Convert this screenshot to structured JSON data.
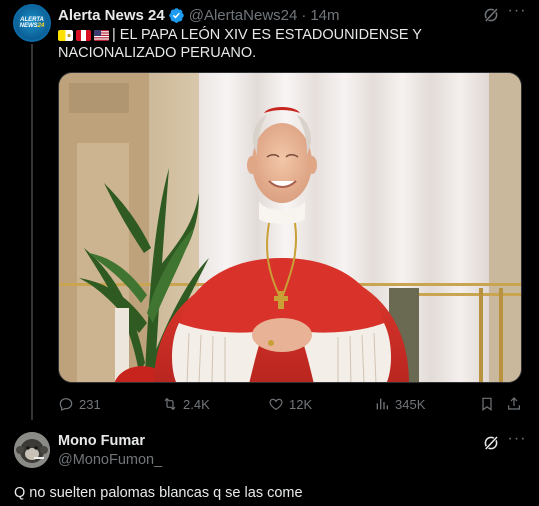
{
  "post": {
    "author_name": "Alerta News 24",
    "author_handle": "@AlertaNews24",
    "separator": "·",
    "time": "14m",
    "avatar_line1": "ALERTA",
    "avatar_line2": "NEWS",
    "avatar_num": "24",
    "text": "| EL PAPA LEÓN XIV ES ESTADOUNIDENSE Y NACIONALIZADO PERUANO.",
    "flags": [
      "vatican-flag",
      "peru-flag",
      "usa-flag"
    ],
    "more_label": "···",
    "stats": {
      "replies": "231",
      "reposts": "2.4K",
      "likes": "12K",
      "views": "345K"
    }
  },
  "reply": {
    "author_name": "Mono Fumar",
    "author_handle": "@MonoFumon_",
    "more_label": "···",
    "text": "Q no suelten palomas blancas q se las come"
  },
  "colors": {
    "background": "#000000",
    "text_primary": "#e7e9ea",
    "text_secondary": "#71767b",
    "verified": "#1d9bf0",
    "cassock_red": "#d8322a"
  }
}
